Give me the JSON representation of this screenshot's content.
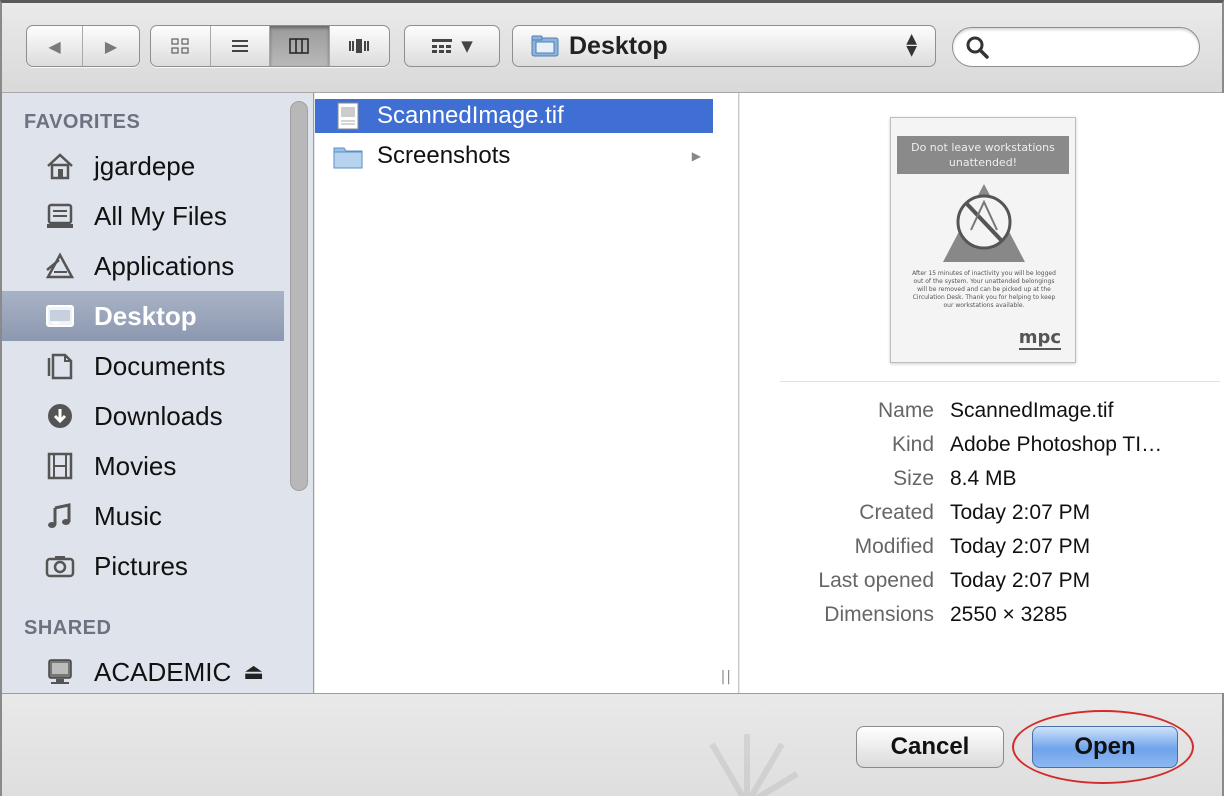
{
  "toolbar": {
    "nav": {
      "back_icon": "back-arrow-icon",
      "forward_icon": "forward-arrow-icon"
    },
    "views": [
      "icon-view-icon",
      "list-view-icon",
      "column-view-icon",
      "coverflow-view-icon"
    ],
    "active_view": "column-view",
    "arrange_icon": "arrange-grid-icon",
    "location": "Desktop",
    "search_placeholder": ""
  },
  "sidebar": {
    "favorites_header": "FAVORITES",
    "favorites": [
      {
        "label": "jgardepe",
        "icon": "home-icon"
      },
      {
        "label": "All My Files",
        "icon": "all-files-icon"
      },
      {
        "label": "Applications",
        "icon": "applications-icon"
      },
      {
        "label": "Desktop",
        "icon": "desktop-icon",
        "selected": true
      },
      {
        "label": "Documents",
        "icon": "documents-icon"
      },
      {
        "label": "Downloads",
        "icon": "downloads-icon"
      },
      {
        "label": "Movies",
        "icon": "movies-icon"
      },
      {
        "label": "Music",
        "icon": "music-icon"
      },
      {
        "label": "Pictures",
        "icon": "pictures-icon"
      }
    ],
    "shared_header": "SHARED",
    "shared": [
      {
        "label": "ACADEMIC",
        "icon": "network-drive-icon",
        "eject": "⏏"
      }
    ]
  },
  "files": [
    {
      "name": "ScannedImage.tif",
      "icon": "tiff-file-icon",
      "selected": true
    },
    {
      "name": "Screenshots",
      "icon": "folder-icon",
      "has_children": true
    }
  ],
  "preview": {
    "thumb_banner": "Do not leave workstations unattended!",
    "thumb_text": "After 15 minutes of inactivity you will be logged out of the system. Your unattended belongings will be removed and can be picked up at the Circulation Desk. Thank you for helping to keep our workstations available.",
    "thumb_logo": "mpc",
    "info": [
      {
        "key": "Name",
        "value": "ScannedImage.tif"
      },
      {
        "key": "Kind",
        "value": "Adobe Photoshop TI…"
      },
      {
        "key": "Size",
        "value": "8.4 MB"
      },
      {
        "key": "Created",
        "value": "Today 2:07 PM"
      },
      {
        "key": "Modified",
        "value": "Today 2:07 PM"
      },
      {
        "key": "Last opened",
        "value": "Today 2:07 PM"
      },
      {
        "key": "Dimensions",
        "value": "2550 × 3285"
      }
    ]
  },
  "buttons": {
    "cancel": "Cancel",
    "open": "Open"
  },
  "colors": {
    "selection": "#3f6fd3",
    "sidebar_selection": "#9aa5bb",
    "highlight_ring": "#d42a2a",
    "open_button": "#6fa3ea"
  }
}
